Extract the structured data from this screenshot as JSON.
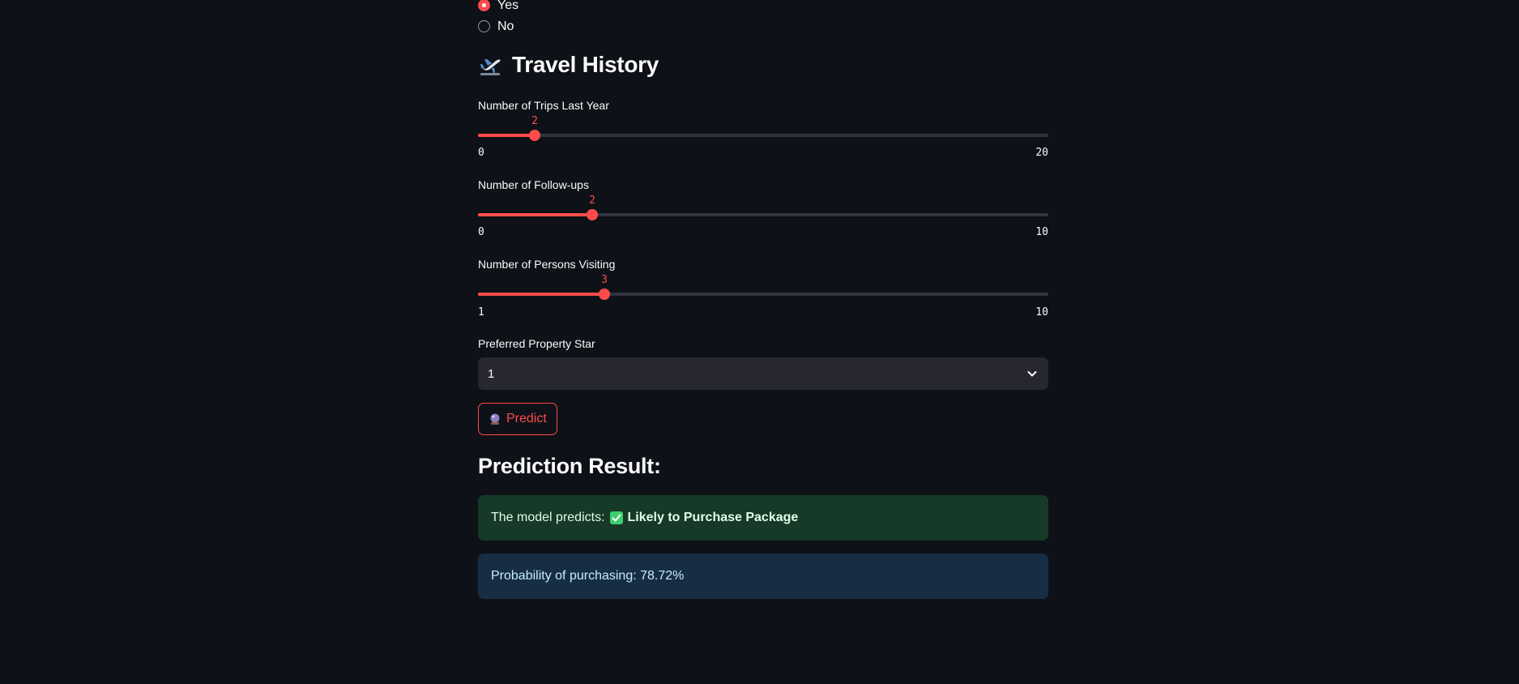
{
  "radio": {
    "options": [
      {
        "label": "Yes",
        "checked": true
      },
      {
        "label": "No",
        "checked": false
      }
    ]
  },
  "travel_history": {
    "heading": "Travel History",
    "icon": "airplane-departure-icon"
  },
  "sliders": [
    {
      "label": "Number of Trips Last Year",
      "value": "2",
      "min": "0",
      "max": "20"
    },
    {
      "label": "Number of Follow-ups",
      "value": "2",
      "min": "0",
      "max": "10"
    },
    {
      "label": "Number of Persons Visiting",
      "value": "3",
      "min": "1",
      "max": "10"
    }
  ],
  "property_star": {
    "label": "Preferred Property Star",
    "selected": "1"
  },
  "predict_button": {
    "label": "Predict",
    "icon": "crystal-ball-icon"
  },
  "result": {
    "heading": "Prediction Result:",
    "prefix": "The model predicts:",
    "prediction": "Likely to Purchase Package",
    "probability_text": "Probability of purchasing: 78.72%"
  },
  "colors": {
    "accent": "#ff4b4b",
    "background": "#0e1117",
    "success_bg": "#173928",
    "info_bg": "#172d43"
  }
}
